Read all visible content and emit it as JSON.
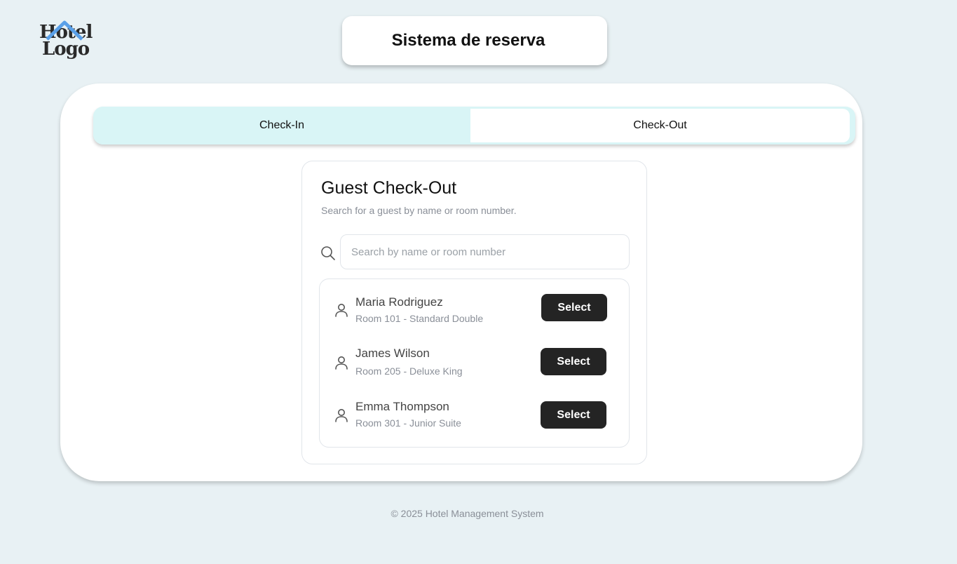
{
  "logo": {
    "line1": "Hotel",
    "line2": "Logo",
    "roof_color": "#5aa0e8"
  },
  "header": {
    "title": "Sistema de reserva"
  },
  "tabs": [
    {
      "label": "Check-In",
      "active": false
    },
    {
      "label": "Check-Out",
      "active": true
    }
  ],
  "panel": {
    "title": "Guest Check-Out",
    "subtitle": "Search for a guest by name or room number.",
    "search": {
      "placeholder": "Search by name or room number",
      "value": ""
    }
  },
  "guests": [
    {
      "name": "Maria Rodriguez",
      "room": "Room 101 - Standard Double",
      "button_label": "Select"
    },
    {
      "name": "James Wilson",
      "room": "Room 205 - Deluxe King",
      "button_label": "Select"
    },
    {
      "name": "Emma Thompson",
      "room": "Room 301 - Junior Suite",
      "button_label": "Select"
    }
  ],
  "footer": {
    "text": "© 2025 Hotel Management System"
  },
  "colors": {
    "background": "#e8f1f4",
    "tab_active_bg": "#d9f5f6",
    "button_bg": "#242424"
  }
}
